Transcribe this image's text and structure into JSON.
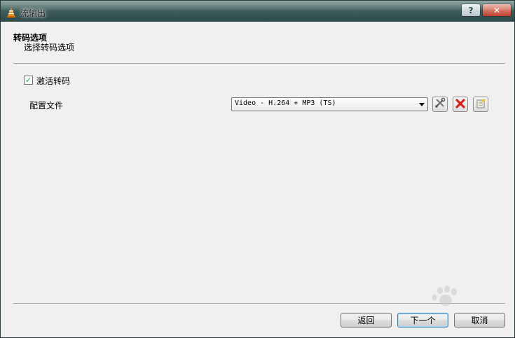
{
  "window": {
    "title": "流输出",
    "help_label": "?",
    "close_label": "✕"
  },
  "header": {
    "title": "转码选项",
    "subtitle": "选择转码选项"
  },
  "transcode": {
    "enable_label": "激活转码",
    "enabled": true,
    "check_glyph": "✓"
  },
  "profile": {
    "label": "配置文件",
    "selected": "Video - H.264 + MP3 (TS)",
    "edit_icon": "tools-icon",
    "delete_icon": "delete-icon",
    "new_icon": "new-profile-icon"
  },
  "footer": {
    "back_label": "返回",
    "next_label": "下一个",
    "cancel_label": "取消"
  },
  "colors": {
    "delete_red": "#d8201c",
    "accent_orange": "#f08a14"
  }
}
